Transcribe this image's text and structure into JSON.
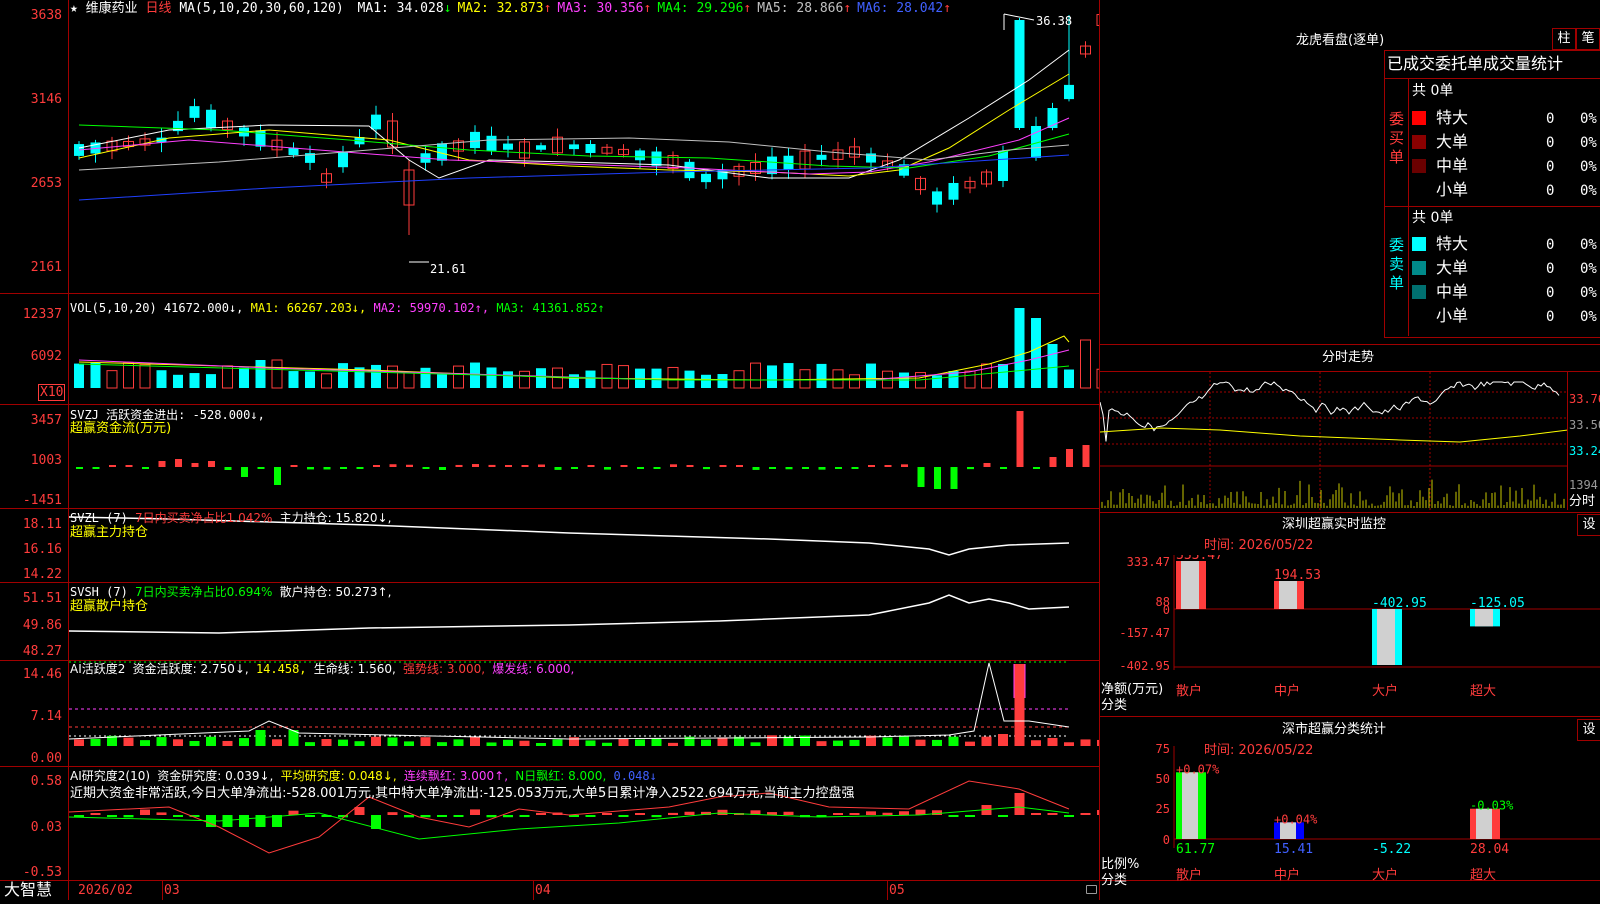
{
  "header": {
    "star": "★",
    "stock_name": "维康药业",
    "period": "日线",
    "ma_params": "MA(5,10,20,30,60,120)",
    "ma": [
      {
        "label": "MA1: 34.028",
        "arrow": "↓",
        "color": "#ffffff"
      },
      {
        "label": "MA2: 32.873",
        "arrow": "↑",
        "color": "#ffff00"
      },
      {
        "label": "MA3: 30.356",
        "arrow": "↑",
        "color": "#ff40ff"
      },
      {
        "label": "MA4: 29.296",
        "arrow": "↑",
        "color": "#00ff00"
      },
      {
        "label": "MA5: 28.866",
        "arrow": "↑",
        "color": "#c0c0c0"
      },
      {
        "label": "MA6: 28.042",
        "arrow": "↑",
        "color": "#4060ff"
      }
    ],
    "high_label": "36.38",
    "low_label": "21.61"
  },
  "price_axis": [
    "3638",
    "3146",
    "2653",
    "2161"
  ],
  "vol": {
    "title": "VOL(5,10,20)",
    "value": "41672.000↓,",
    "ma1": "MA1: 66267.203↓,",
    "ma2": "MA2: 59970.102↑,",
    "ma3": "MA3: 41361.852↑",
    "axis": [
      "12337",
      "6092"
    ],
    "unit": "X10"
  },
  "svzj": {
    "title": "SVZJ  活跃资金进出: -528.000↓,",
    "subtitle": "超赢资金流(万元)",
    "axis": [
      "3457",
      "1003",
      "-1451"
    ]
  },
  "svzl": {
    "title": "SVZL (7)",
    "ratio": "7日内买卖净占比1.042%",
    "hold": "主力持仓: 15.820↓,",
    "subtitle": "超赢主力持仓",
    "axis": [
      "18.11",
      "16.16",
      "14.22"
    ]
  },
  "svsh": {
    "title": "SVSH (7)",
    "ratio": "7日内买卖净占比0.694%",
    "hold": "散户持仓: 50.273↑,",
    "subtitle": "超赢散户持仓",
    "axis": [
      "51.51",
      "49.86",
      "48.27"
    ]
  },
  "ai_active": {
    "title": "AI活跃度2",
    "a": "资金活跃度: 2.750↓,",
    "b": "14.458,",
    "c": "生命线: 1.560,",
    "d": "强势线: 3.000,",
    "e": "爆发线: 6.000,",
    "axis": [
      "14.46",
      "7.14",
      "0.00"
    ]
  },
  "ai_research": {
    "title": "AI研究度2(10)",
    "a": "资金研究度: 0.039↓,",
    "b": "平均研究度: 0.048↓,",
    "c": "连续飘红: 3.000↑,",
    "d": "N日飘红: 8.000,",
    "e": "0.048↓",
    "comment": "近期大资金非常活跃,今日大单净流出:-528.001万元,其中特大单净流出:-125.053万元,大单5日累计净入2522.694万元,当前主力控盘强",
    "axis": [
      "0.58",
      "0.03",
      "-0.53"
    ]
  },
  "bottom": {
    "logo": "大智慧",
    "dates": [
      "2026/02",
      "03",
      "04",
      "05"
    ]
  },
  "dragon": {
    "title": "龙虎看盘(逐单)",
    "btn_bar": "柱",
    "btn_pen": "笔",
    "stats_title": "已成交委托单成交量统计",
    "buy_side": "委买单",
    "sell_side": "委卖单",
    "buy_total": "共 0单",
    "sell_total": "共 0单",
    "buy_rows": [
      {
        "label": "特大",
        "value": "0",
        "pct": "0%",
        "color": "#ff0000"
      },
      {
        "label": "大单",
        "value": "0",
        "pct": "0%",
        "color": "#8a0000"
      },
      {
        "label": "中单",
        "value": "0",
        "pct": "0%",
        "color": "#6a0000"
      },
      {
        "label": "小单",
        "value": "0",
        "pct": "0%",
        "color": ""
      }
    ],
    "sell_rows": [
      {
        "label": "特大",
        "value": "0",
        "pct": "0%",
        "color": "#00ffff"
      },
      {
        "label": "大单",
        "value": "0",
        "pct": "0%",
        "color": "#008a8a"
      },
      {
        "label": "中单",
        "value": "0",
        "pct": "0%",
        "color": "#007070"
      },
      {
        "label": "小单",
        "value": "0",
        "pct": "0%",
        "color": ""
      }
    ]
  },
  "intraday": {
    "title": "分时走势",
    "axis": [
      "33.76",
      "33.50",
      "33.24"
    ],
    "vol_label": "1394",
    "time_label": "分时"
  },
  "monitor": {
    "title": "深圳超赢实时监控",
    "settings": "设",
    "time": "时间: 2026/05/22",
    "axis": [
      "333.47",
      "88",
      "0",
      "-157.47",
      "-402.95"
    ],
    "y_unit": "净额(万元)",
    "x_unit": "分类",
    "categories": [
      "散户",
      "中户",
      "大户",
      "超大"
    ],
    "values": [
      333.47,
      194.53,
      -402.95,
      -125.05
    ],
    "value_labels": [
      "333.47",
      "194.53",
      "-402.95",
      "-125.05"
    ]
  },
  "classify": {
    "title": "深市超赢分类统计",
    "settings": "设",
    "time": "时间: 2026/05/22",
    "axis": [
      "75",
      "50",
      "25",
      "0"
    ],
    "y_unit": "比例%",
    "x_unit": "分类",
    "categories": [
      "散户",
      "中户",
      "大户",
      "超大"
    ],
    "values": [
      61.77,
      15.41,
      -5.22,
      28.04
    ],
    "top_labels": [
      "+0.07%",
      "+0.04%",
      "",
      "-0.03%"
    ],
    "bottom_labels": [
      "61.77",
      "15.41",
      "-5.22",
      "28.04"
    ]
  },
  "colors": {
    "up": "#ff3c3c",
    "down": "#00ffff",
    "border": "#a00000"
  }
}
